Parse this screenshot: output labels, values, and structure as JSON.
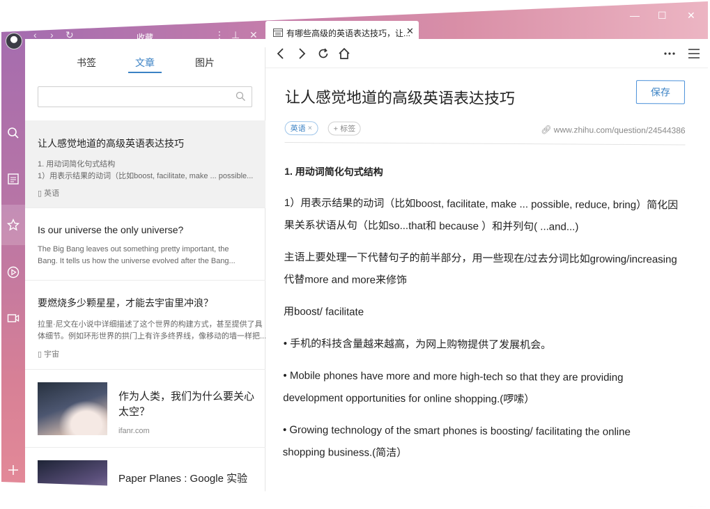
{
  "sidebar": {
    "title": "收藏",
    "tabs": [
      "书签",
      "文章",
      "图片"
    ],
    "active_tab": "文章",
    "search": {
      "value": "",
      "placeholder": ""
    },
    "articles": [
      {
        "title": "让人感觉地道的高级英语表达技巧",
        "snippet1": "1. 用动词简化句式结构",
        "snippet2": "1）用表示结果的动词（比如boost, facilitate, make ... possible...",
        "tag": "英语"
      },
      {
        "title": "Is our universe the only universe?",
        "snippet1": "The Big Bang leaves out something pretty important, the",
        "snippet2": "Bang. It tells us how the universe evolved after the Bang..."
      },
      {
        "title": "要燃烧多少颗星星，才能去宇宙里冲浪？",
        "snippet1": "拉里·尼文在小说中详细描述了这个世界的构建方式，甚至提供了具",
        "snippet2": "体细节。例如环形世界的拱门上有许多终界线，像移动的墙一样把...",
        "tag": "宇宙"
      },
      {
        "title_line1": "作为人类，我们为什么要关心",
        "title_line2": "太空？",
        "source": "ifanr.com"
      },
      {
        "title_line1": "Paper Planes : Google 实验"
      }
    ]
  },
  "browser": {
    "tab_title": "有哪些高级的英语表达技巧，让...",
    "window_controls": [
      "minimize",
      "maximize",
      "close"
    ]
  },
  "article": {
    "title": "让人感觉地道的高级英语表达技巧",
    "save_label": "保存",
    "tag": "英语",
    "add_tag_label": "+ 标签",
    "url": "www.zhihu.com/question/24544386",
    "heading": "1. 用动词简化句式结构",
    "p1_line1": "1）用表示结果的动词（比如boost, facilitate, make ... possible, reduce, bring）简化因",
    "p1_line2": "果关系状语从句（比如so...that和 because ）和并列句( ...and...)",
    "p2_line1": "主语上要处理一下代替句子的前半部分，用一些现在/过去分词比如growing/increasing",
    "p2_line2": "代替more and more来修饰",
    "p3": "用boost/ facilitate",
    "p4": "• 手机的科技含量越来越高，为网上购物提供了发展机会。",
    "p5_line1": "• Mobile phones have more and more high-tech so that  they are providing",
    "p5_line2": "development opportunities for online shopping.(啰嗦）",
    "p6_line1": "• Growing technology of the smart phones is boosting/ facilitating the online",
    "p6_line2": "shopping business.(简洁）"
  },
  "colors": {
    "accent": "#3b82c4",
    "gradient_start": "#a26bb0",
    "gradient_end": "#ecb5c3"
  }
}
